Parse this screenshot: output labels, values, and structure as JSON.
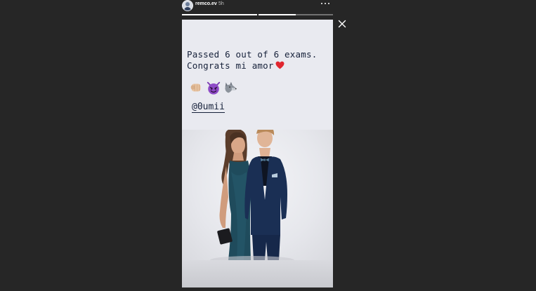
{
  "header": {
    "username": "remco.ev",
    "timestamp": "5h",
    "progress": [
      1.0,
      0.5
    ]
  },
  "story": {
    "caption_line1": "Passed 6 out of 6 exams.",
    "caption_line2": "Congrats mi amor",
    "emojis": [
      "fist-bump-icon",
      "smiling-imp-icon",
      "wolf-icon"
    ],
    "mention": "@0umii"
  },
  "colors": {
    "background": "#262626",
    "story_background": "#e9eaf0",
    "text": "#16213a",
    "heart": "#e0262f"
  }
}
